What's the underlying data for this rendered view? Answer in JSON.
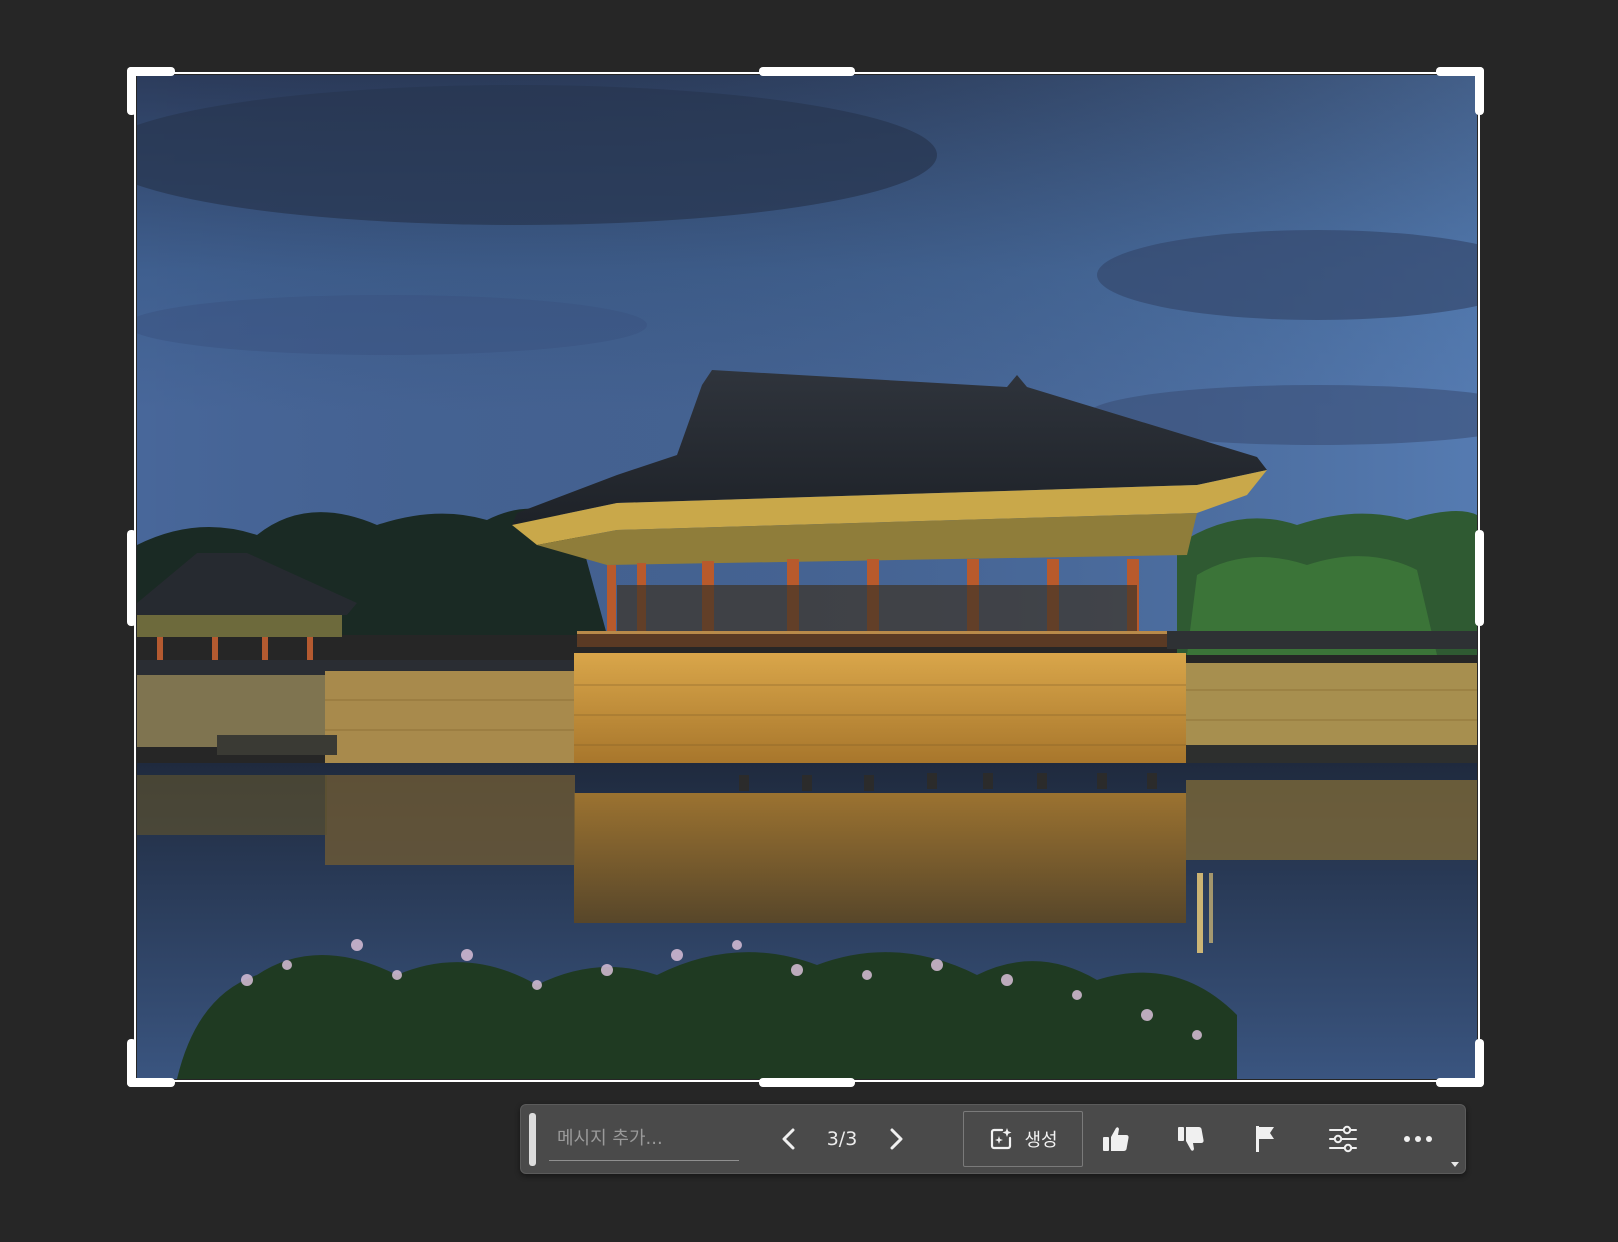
{
  "toolbar": {
    "message_placeholder": "메시지 추가...",
    "message_value": "",
    "counter": "3/3",
    "generate_label": "생성"
  },
  "icons": {
    "prev": "chevron-left-icon",
    "next": "chevron-right-icon",
    "generate": "sparkle-edit-icon",
    "like": "thumbs-up-icon",
    "dislike": "thumbs-down-icon",
    "flag": "flag-icon",
    "settings": "sliders-icon",
    "more": "ellipsis-icon"
  },
  "colors": {
    "background": "#262626",
    "toolbar": "#4a4a4a",
    "frame": "#ffffff"
  }
}
